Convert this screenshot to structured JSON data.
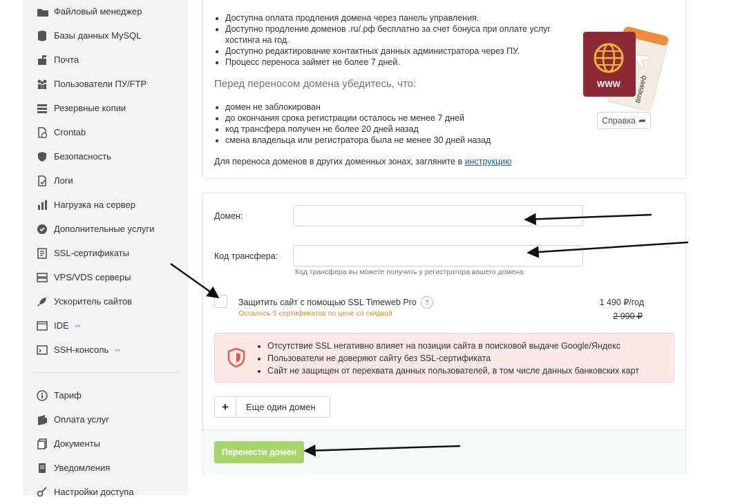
{
  "sidebar": {
    "items": [
      {
        "label": "Файловый менеджер",
        "icon": "folder-icon"
      },
      {
        "label": "Базы данных MySQL",
        "icon": "database-icon"
      },
      {
        "label": "Почта",
        "icon": "mailbox-icon"
      },
      {
        "label": "Пользователи ПУ/FTP",
        "icon": "users-icon"
      },
      {
        "label": "Резервные копии",
        "icon": "backup-icon"
      },
      {
        "label": "Crontab",
        "icon": "clock-document-icon"
      },
      {
        "label": "Безопасность",
        "icon": "shield-icon"
      },
      {
        "label": "Логи",
        "icon": "log-icon"
      },
      {
        "label": "Нагрузка на сервер",
        "icon": "bar-chart-icon"
      },
      {
        "label": "Дополнительные услуги",
        "icon": "badge-check-icon"
      },
      {
        "label": "SSL-сертификаты",
        "icon": "certificate-icon"
      },
      {
        "label": "VPS/VDS серверы",
        "icon": "server-icon"
      },
      {
        "label": "Ускоритель сайтов",
        "icon": "rocket-icon"
      },
      {
        "label": "IDE",
        "icon": "ide-icon"
      },
      {
        "label": "SSH-консоль",
        "icon": "terminal-icon"
      }
    ],
    "items2": [
      {
        "label": "Тариф",
        "icon": "info-icon"
      },
      {
        "label": "Оплата услуг",
        "icon": "wallet-icon"
      },
      {
        "label": "Документы",
        "icon": "documents-icon"
      },
      {
        "label": "Уведомления",
        "icon": "notification-icon"
      },
      {
        "label": "Настройки доступа",
        "icon": "key-icon"
      }
    ]
  },
  "info": {
    "bullets": [
      "Доступна оплата продления домена через панель управления.",
      "Доступно продление доменов .ru/.рф бесплатно за счет бонуса при оплате услуг хостинга на год.",
      "Доступно редактирование контактных данных администратора через ПУ.",
      "Процесс переноса займет не более 7 дней."
    ],
    "subheading": "Перед переносом домена убедитесь, что:",
    "checks": [
      "домен не заблокирован",
      "до окончания срока регистрации осталось не менее 7 дней",
      "код трансфера получен не более 20 дней назад",
      "смена владельца или регистратора была не менее 30 дней назад"
    ],
    "other_zones_text": "Для переноса доменов в других доменных зонах, загляните в ",
    "other_zones_link": "инструкцию",
    "help_label": "Справка",
    "passport_www": "WWW",
    "ticket_brand": "timeweb"
  },
  "form": {
    "domain_label": "Домен:",
    "domain_value": "",
    "code_label": "Код трансфера:",
    "code_value": "",
    "code_hint": "Код трансфера вы можете получить у регистратора вашего домена",
    "ssl_label": "Защитить сайт с помощью SSL Timeweb Pro",
    "ssl_help": "?",
    "ssl_note": "Осталось 5 сертификатов по цене со скидкой",
    "price": "1 490 ₽/год",
    "old_price": "2 990 ₽",
    "warnings": [
      "Отсутствие SSL негативно влияет на позиции сайта в поисковой выдаче Google/Яндекс",
      "Пользователи не доверяют сайту без SSL-сертификата",
      "Сайт не защищен от перехвата данных пользователей, в том числе данных банковских карт"
    ],
    "add_domain_label": "Еще один домен",
    "submit_label": "Перенести домен"
  },
  "colors": {
    "submit_bg": "#a6d66b",
    "ssl_note": "#d08a2b",
    "warning_bg": "#fde8e8",
    "link": "#1b5fa8"
  }
}
